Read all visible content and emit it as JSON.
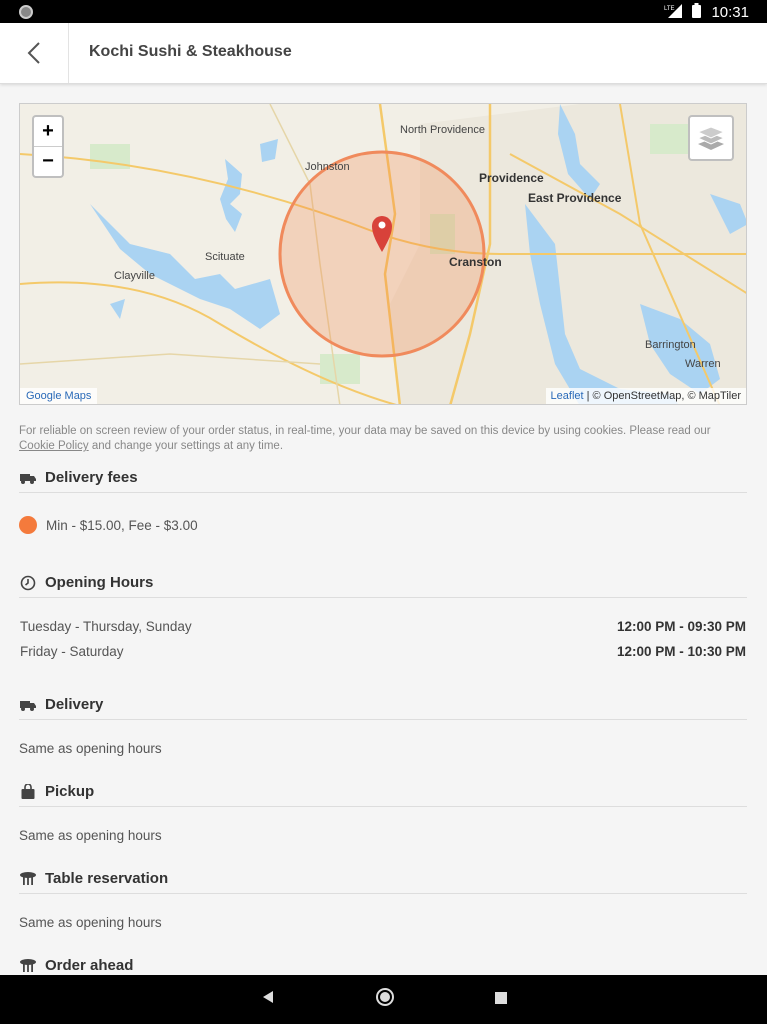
{
  "status_bar": {
    "time": "10:31",
    "network": "LTE"
  },
  "header": {
    "title": "Kochi Sushi & Steakhouse"
  },
  "map": {
    "zoom_in": "+",
    "zoom_out": "−",
    "credit_left": "Google Maps",
    "credit_leaflet": "Leaflet",
    "credit_right": " | © OpenStreetMap, © MapTiler",
    "labels": {
      "north_providence": "North Providence",
      "providence": "Providence",
      "east_providence": "East Providence",
      "johnston": "Johnston",
      "cranston": "Cranston",
      "scituate": "Scituate",
      "clayville": "Clayville",
      "barrington": "Barrington",
      "warren": "Warren"
    }
  },
  "cookie": {
    "text": "For reliable on screen review of your order status, in real-time, your data may be saved on this device by using cookies. Please read our ",
    "link": "Cookie Policy",
    "text_after": " and change your settings at any time."
  },
  "sections": {
    "delivery_fees": {
      "title": "Delivery fees",
      "fee_text": "Min - $15.00, Fee - $3.00",
      "dot_color": "#f47a3c"
    },
    "opening_hours": {
      "title": "Opening Hours",
      "rows": [
        {
          "days": "Tuesday - Thursday, Sunday",
          "time": "12:00 PM - 09:30 PM"
        },
        {
          "days": "Friday - Saturday",
          "time": "12:00 PM - 10:30 PM"
        }
      ]
    },
    "delivery": {
      "title": "Delivery",
      "text": "Same as opening hours"
    },
    "pickup": {
      "title": "Pickup",
      "text": "Same as opening hours"
    },
    "table_reservation": {
      "title": "Table reservation",
      "text": "Same as opening hours"
    },
    "order_ahead": {
      "title": "Order ahead"
    }
  },
  "colors": {
    "accent": "#f47a3c",
    "water": "#aad3f2",
    "link": "#2a6ab8"
  }
}
